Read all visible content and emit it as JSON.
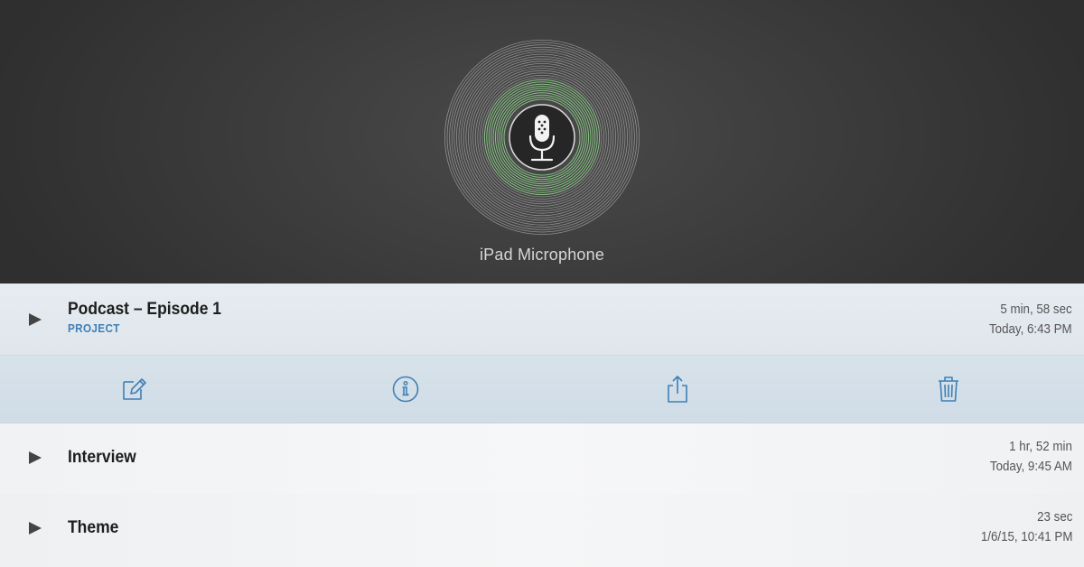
{
  "recorder": {
    "source_label": "iPad Microphone"
  },
  "recordings": [
    {
      "title": "Podcast – Episode 1",
      "subtitle": "PROJECT",
      "duration": "5 min, 58 sec",
      "date": "Today, 6:43 PM",
      "expanded": true
    },
    {
      "title": "Interview",
      "duration": "1 hr, 52 min",
      "date": "Today, 9:45 AM"
    },
    {
      "title": "Theme",
      "duration": "23 sec",
      "date": "1/6/15, 10:41 PM"
    }
  ],
  "actions": [
    {
      "icon": "edit-icon"
    },
    {
      "icon": "info-icon"
    },
    {
      "icon": "share-icon"
    },
    {
      "icon": "trash-icon"
    }
  ],
  "colors": {
    "accent": "#3f7fb6",
    "level_ring": "#8fcf8c",
    "header_bg": "#3b3b3b"
  }
}
